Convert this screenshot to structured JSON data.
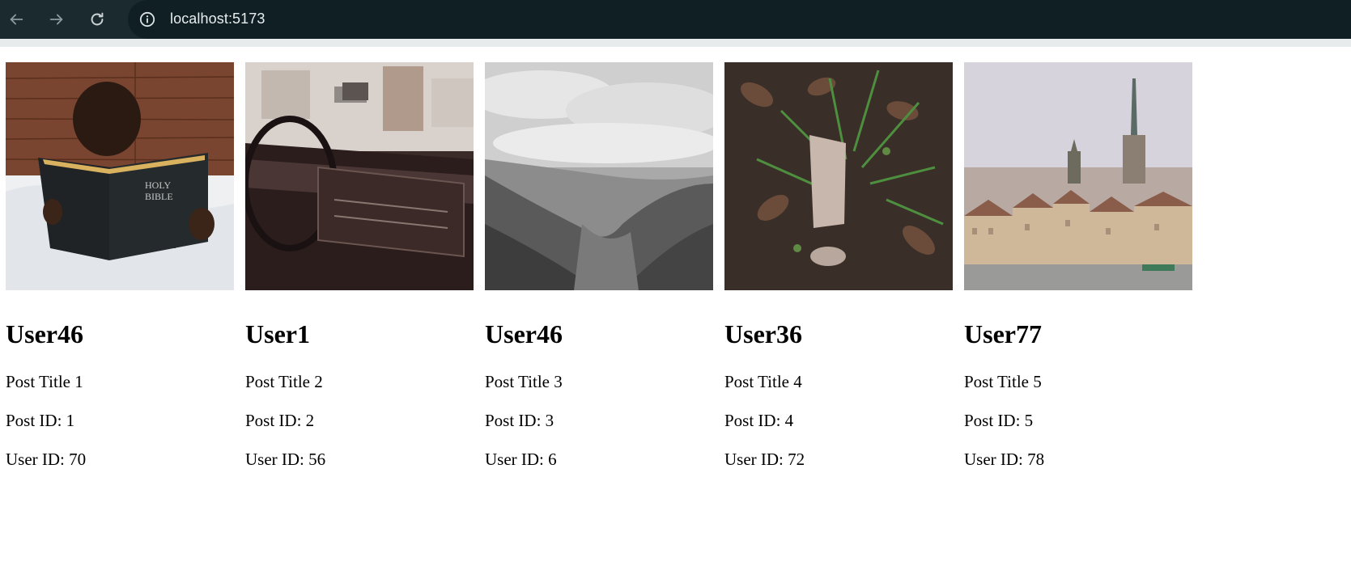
{
  "browser": {
    "url": "localhost:5173"
  },
  "posts": [
    {
      "username": "User46",
      "title": "Post Title 1",
      "post_id": "Post ID: 1",
      "user_id": "User ID: 70",
      "image": "child-reading-holy-bible"
    },
    {
      "username": "User1",
      "title": "Post Title 2",
      "post_id": "Post ID: 2",
      "user_id": "User ID: 56",
      "image": "vintage-car-dashboard"
    },
    {
      "username": "User46",
      "title": "Post Title 3",
      "post_id": "Post ID: 3",
      "user_id": "User ID: 6",
      "image": "black-and-white-forest-valley"
    },
    {
      "username": "User36",
      "title": "Post Title 4",
      "post_id": "Post ID: 4",
      "user_id": "User ID: 72",
      "image": "leaves-and-grass-ground"
    },
    {
      "username": "User77",
      "title": "Post Title 5",
      "post_id": "Post ID: 5",
      "user_id": "User ID: 78",
      "image": "old-town-city-skyline"
    }
  ],
  "colors": {
    "toolbar": "#1b2a2f",
    "omnibox": "#0f1f24"
  }
}
